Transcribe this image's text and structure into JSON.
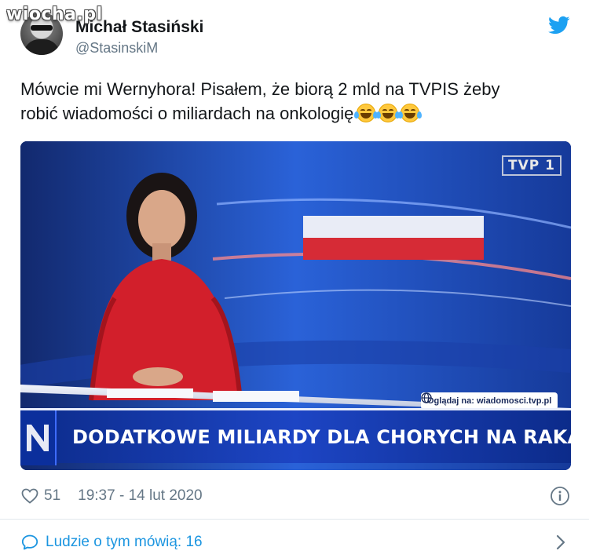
{
  "watermark": "wiocha.pl",
  "author": {
    "name": "Michał Stasiński",
    "handle": "@StasinskiM"
  },
  "tweet": {
    "text_line1": "Mówcie mi Wernyhora! Pisałem, że biorą 2 mld na TVPIS żeby",
    "text_line2": "robić wiadomości o miliardach na onkologię",
    "emojis": [
      "face-with-tears-of-joy",
      "face-with-tears-of-joy",
      "face-with-tears-of-joy"
    ]
  },
  "media": {
    "channel_logo": "TVP 1",
    "website_badge": "Oglądaj na: wiadomosci.tvp.pl",
    "headline": "DODATKOWE MILIARDY DLA CHORYCH NA RAKA"
  },
  "meta": {
    "likes": "51",
    "timestamp": "19:37 - 14 lut 2020"
  },
  "footer": {
    "people_talking": "Ludzie o tym mówią: 16"
  },
  "colors": {
    "twitter_blue": "#1da1f2",
    "link_blue": "#1b95e0",
    "muted_gray": "#657786",
    "text": "#14171a"
  },
  "icons": [
    "twitter-bird-icon",
    "heart-icon",
    "info-icon",
    "chat-bubble-icon",
    "chevron-right-icon",
    "globe-icon"
  ]
}
